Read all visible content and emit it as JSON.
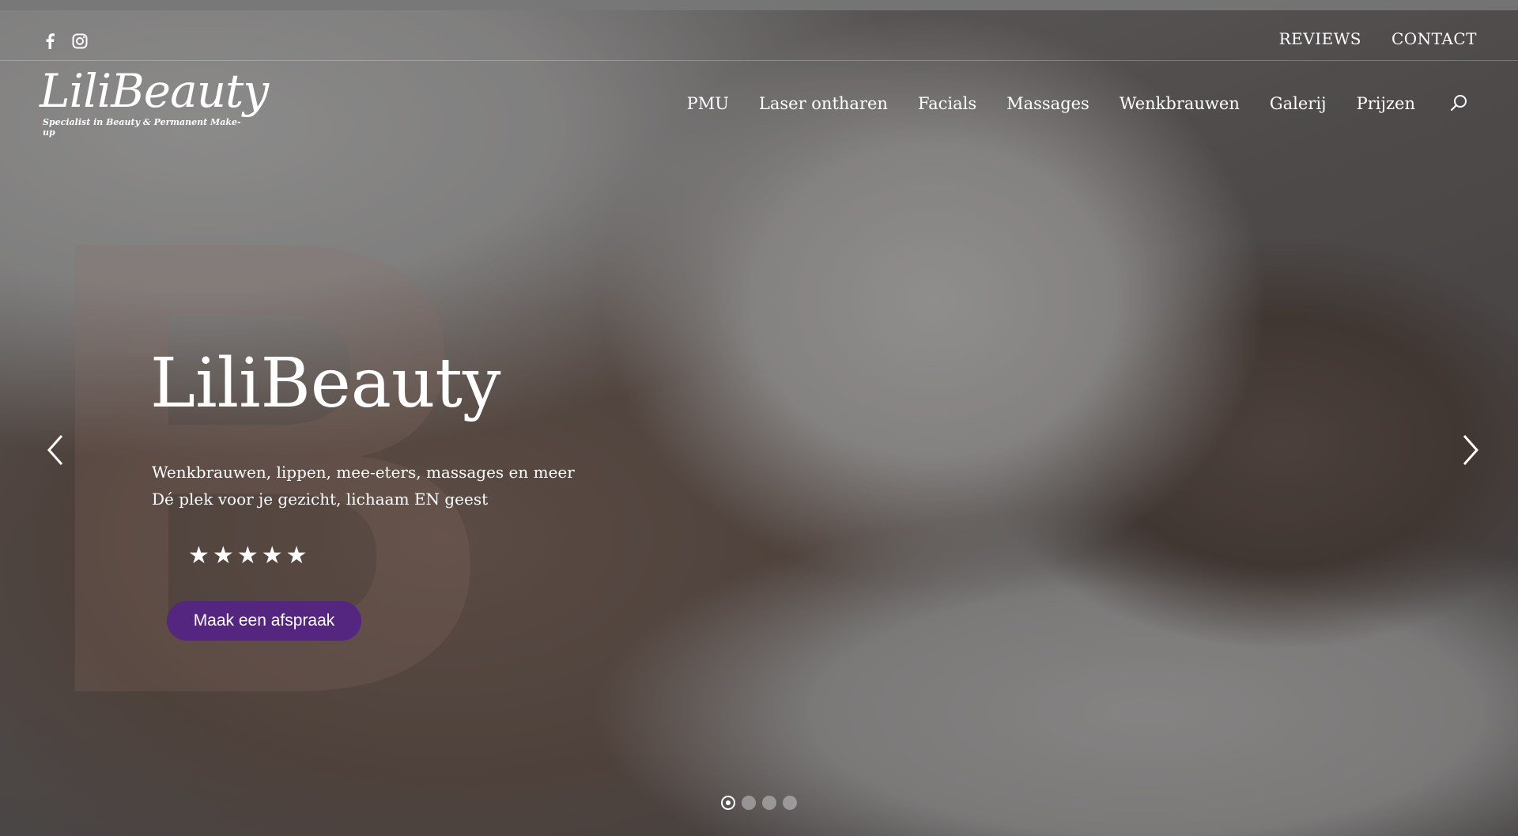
{
  "colors": {
    "accent": "#54267f",
    "text": "#ffffff"
  },
  "topbar": {
    "social": [
      {
        "icon": "facebook-icon"
      },
      {
        "icon": "instagram-icon"
      }
    ],
    "links": [
      "REVIEWS",
      "CONTACT"
    ]
  },
  "logo": {
    "name": "LiliBeauty",
    "tagline": "Specialist in Beauty & Permanent Make-up"
  },
  "nav": {
    "items": [
      "PMU",
      "Laser ontharen",
      "Facials",
      "Massages",
      "Wenkbrauwen",
      "Galerij",
      "Prijzen"
    ],
    "search_icon": "search-icon"
  },
  "hero": {
    "background_letter": "B",
    "title": "LiliBeauty",
    "subtitle_line1": "Wenkbrauwen, lippen, mee-eters, massages en meer",
    "subtitle_line2": "Dé plek voor je gezicht, lichaam EN geest",
    "rating": 5,
    "cta_label": "Maak een afspraak"
  },
  "slider": {
    "prev_icon": "chevron-left-icon",
    "next_icon": "chevron-right-icon",
    "slide_count": 4,
    "active_slide": 1
  }
}
